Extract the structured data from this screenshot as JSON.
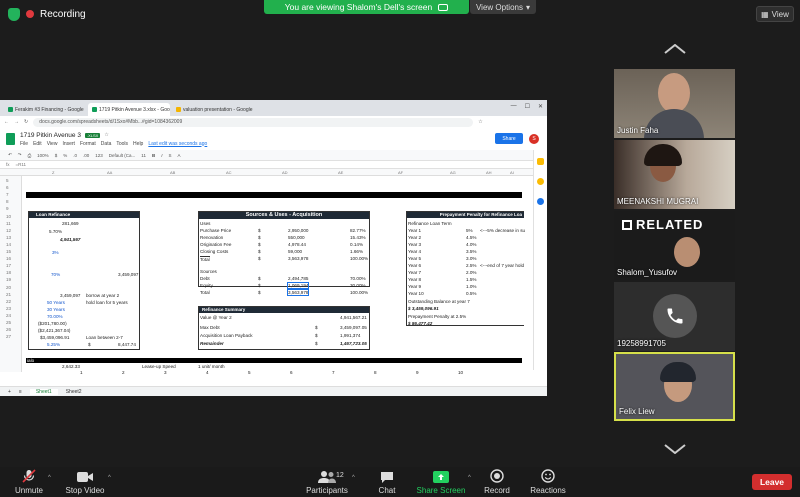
{
  "zoom": {
    "recording_label": "Recording",
    "banner_text": "You are viewing Shalom's Dell's screen",
    "view_options": "View Options",
    "view_button": "View",
    "colors": {
      "accent_green": "#23b35c",
      "leave_red": "#d32e2e",
      "highlight": "#d6e04a"
    }
  },
  "browser": {
    "tabs": [
      {
        "label": "Ferakim #3 Financing - Google"
      },
      {
        "label": "1719 Pitkin Avenue 3.xlsx - Goo"
      },
      {
        "label": "valuation presentation - Google"
      }
    ],
    "url": "docs.google.com/spreadsheets/d/1Sxo#Mbb...#gid=1084362009"
  },
  "sheet": {
    "title": "1719 Pitkin Avenue 3",
    "badge": ".XLSX",
    "menu": [
      "File",
      "Edit",
      "View",
      "Insert",
      "Format",
      "Data",
      "Tools",
      "Help"
    ],
    "last_edit": "Last edit was seconds ago",
    "share_label": "Share",
    "avatar": "S",
    "toolbar": [
      "100%",
      "$",
      "%",
      ".0",
      ".00",
      "123",
      "Default (Ca...",
      "11",
      "B",
      "I",
      "S",
      "A"
    ],
    "formula_ref": "fx",
    "formula": "=R11",
    "columns": [
      "Z",
      "AA",
      "AB",
      "AC",
      "AD",
      "AE",
      "AF",
      "AG",
      "AH",
      "AI"
    ],
    "rows": [
      "5",
      "6",
      "7",
      "8",
      "9",
      "10",
      "11",
      "12",
      "13",
      "14",
      "15",
      "16",
      "17",
      "18",
      "19",
      "20",
      "21",
      "22",
      "23",
      "24",
      "25",
      "26",
      "27"
    ],
    "left": {
      "header": "Loan Refinance",
      "values": [
        "281,669",
        "5.70%",
        "4,941,567",
        "3%",
        "70%",
        "3,459,097",
        "3,459,097",
        "50 Years",
        "30 Years",
        "70.00%",
        "($201,780.00)",
        "($2,421,367.04)",
        "$3,459,096.91",
        "5.25%",
        "$",
        "8,447.74"
      ],
      "notes": [
        "borrow at year 2",
        "hold loan for 5 years",
        "Loan between 2-7"
      ]
    },
    "middle": {
      "header": "Sources & Uses - Acquisition",
      "uses_label": "Uses",
      "uses": [
        {
          "label": "Purchase Price",
          "cur": "$",
          "amt": "2,950,000",
          "pct": "82.77%"
        },
        {
          "label": "Renovation",
          "cur": "$",
          "amt": "550,000",
          "pct": "15.43%"
        },
        {
          "label": "Origination Fee",
          "cur": "$",
          "amt": "4,978.44",
          "pct": "0.14%"
        },
        {
          "label": "Closing Costs",
          "cur": "$",
          "amt": "59,000",
          "pct": "1.66%"
        },
        {
          "label": "Total",
          "cur": "$",
          "amt": "3,563,978",
          "pct": "100.00%"
        }
      ],
      "sources_label": "Sources",
      "sources": [
        {
          "label": "Debt",
          "cur": "$",
          "amt": "2,494,785",
          "pct": "70.00%"
        },
        {
          "label": "Equity",
          "cur": "$",
          "amt": "1,069,194",
          "pct": "30.00%"
        },
        {
          "label": "Total",
          "cur": "$",
          "amt": "3,563,978",
          "pct": "100.00%"
        }
      ],
      "refi_header": "Refinance Summary",
      "refi": [
        {
          "label": "Value @ Year 2",
          "cur": "",
          "amt": "4,941,567.21"
        },
        {
          "label": "Max Debt",
          "cur": "$",
          "amt": "3,459,097.05"
        },
        {
          "label": "Acquisition Loan Payback",
          "cur": "$",
          "amt": "1,991,374"
        },
        {
          "label": "Remainder",
          "cur": "$",
          "amt": "1,467,723.05"
        }
      ]
    },
    "right": {
      "header": "Prepayment Penalty for Refinance Loa",
      "sub": "Refinance Loan Term",
      "years": [
        {
          "label": "Year 1",
          "pct": "5%",
          "note": "<---5% decrease in su"
        },
        {
          "label": "Year 2",
          "pct": "4.5%",
          "note": ""
        },
        {
          "label": "Year 3",
          "pct": "4.0%",
          "note": ""
        },
        {
          "label": "Year 4",
          "pct": "3.5%",
          "note": ""
        },
        {
          "label": "Year 5",
          "pct": "3.0%",
          "note": ""
        },
        {
          "label": "Year 6",
          "pct": "2.5%",
          "note": "<---end of 7 year hold"
        },
        {
          "label": "Year 7",
          "pct": "2.0%",
          "note": ""
        },
        {
          "label": "Year 8",
          "pct": "1.5%",
          "note": ""
        },
        {
          "label": "Year 9",
          "pct": "1.0%",
          "note": ""
        },
        {
          "label": "Year 10",
          "pct": "0.5%",
          "note": ""
        }
      ],
      "outstanding": "Outstanding Balance at year 7",
      "outstanding_val": "$ 3,459,096.91",
      "penalty_label": "Prepayment Penalty at 2.5%",
      "penalty_val": "$ 86,477.42"
    },
    "bottom": {
      "row25": "ialo",
      "row26_val": "2,642.33",
      "row26_a": "Lease-up Speed",
      "row26_b": "1 unit/ month",
      "row27": [
        "1",
        "2",
        "3",
        "4",
        "5",
        "6",
        "7",
        "8",
        "9",
        "10"
      ]
    },
    "sheet_tabs": [
      "Sheet1",
      "Sheet2"
    ]
  },
  "participants": [
    {
      "name": "Justin Faha"
    },
    {
      "name": "MEENAKSHI MUGRAI"
    },
    {
      "name": "Shalom_Yusufov",
      "brand": "RELATED"
    },
    {
      "name": "19258991705"
    },
    {
      "name": "Felix Liew"
    }
  ],
  "toolbar": {
    "unmute": "Unmute",
    "stop_video": "Stop Video",
    "participants": "Participants",
    "participant_count": "12",
    "chat": "Chat",
    "share_screen": "Share Screen",
    "record": "Record",
    "reactions": "Reactions",
    "leave": "Leave"
  }
}
